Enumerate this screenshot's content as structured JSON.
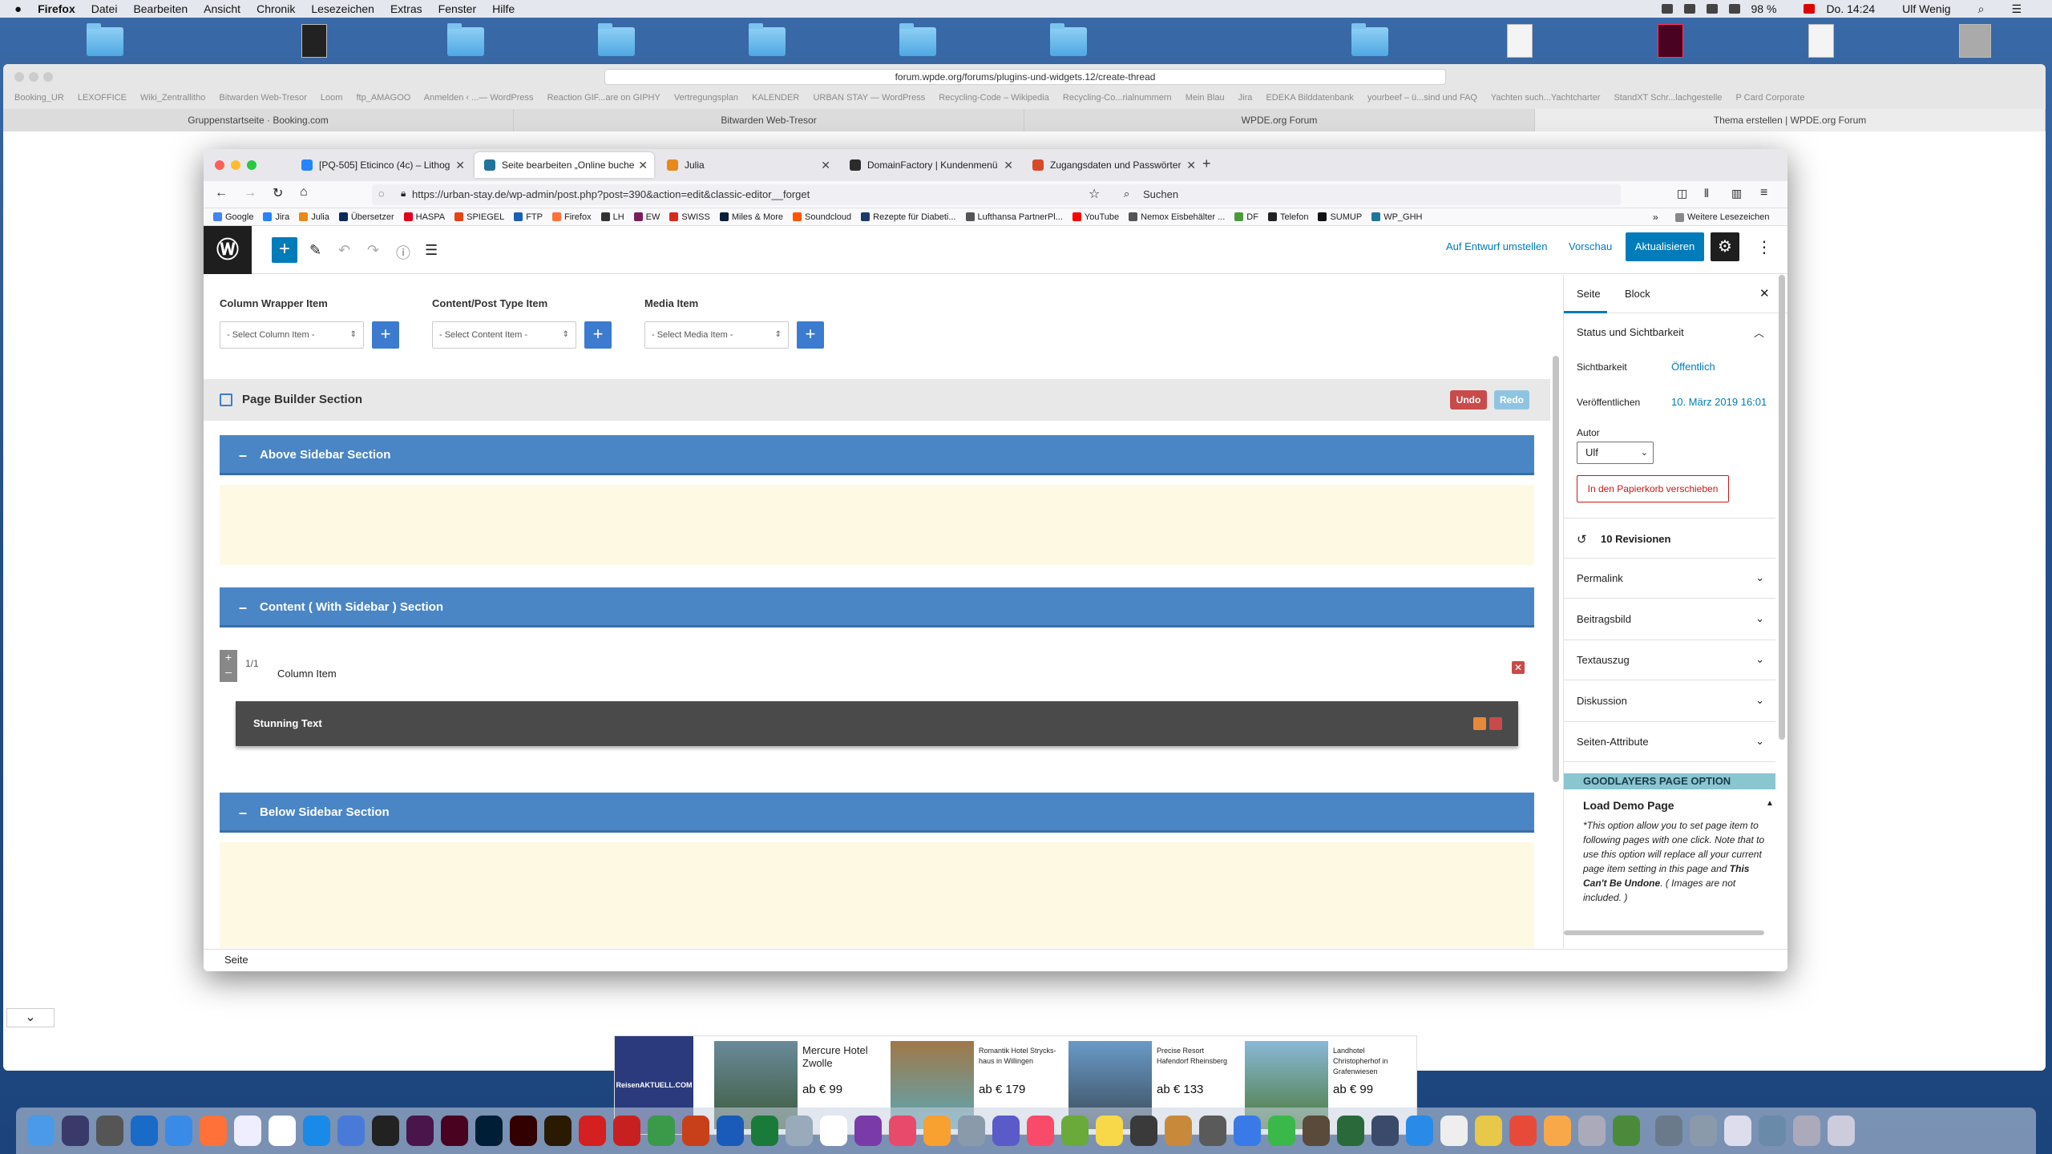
{
  "menubar": {
    "app": "Firefox",
    "items": [
      "Datei",
      "Bearbeiten",
      "Ansicht",
      "Chronik",
      "Lesezeichen",
      "Extras",
      "Fenster",
      "Hilfe"
    ],
    "battery": "98 %",
    "clock": "Do. 14:24",
    "user": "Ulf Wenig"
  },
  "bg_browser": {
    "url": "forum.wpde.org/forums/plugins-und-widgets.12/create-thread",
    "bookmarks": [
      "Booking_UR",
      "LEXOFFICE",
      "Wiki_Zentrallitho",
      "Bitwarden Web-Tresor",
      "Loom",
      "ftp_AMAGOO",
      "Anmelden ‹ ...— WordPress",
      "Reaction GIF...are on GIPHY",
      "Vertregungsplan",
      "KALENDER",
      "URBAN STAY — WordPress",
      "Recycling-Code – Wikipedia",
      "Recycling-Co...rialnummern",
      "Mein Blau",
      "Jira",
      "EDEKA Bilddatenbank",
      "yourbeef – ü...sind und FAQ",
      "Yachten such...Yachtcharter",
      "StandXT Schr...lachgestelle",
      "P Card Corporate"
    ],
    "tabs": [
      "Gruppenstartseite · Booking.com",
      "Bitwarden Web-Tresor",
      "WPDE.org Forum",
      "Thema erstellen | WPDE.org Forum"
    ]
  },
  "firefox": {
    "tabs": [
      {
        "label": "[PQ-505] Eticinco (4c) – Lithog",
        "color": "#2684ff"
      },
      {
        "label": "Seite bearbeiten „Online buche",
        "color": "#21759b"
      },
      {
        "label": "Julia",
        "color": "#e8891a"
      },
      {
        "label": "DomainFactory | Kundenmenü",
        "color": "#2b2b2b"
      },
      {
        "label": "Zugangsdaten und Passwörter",
        "color": "#d64a2a"
      }
    ],
    "url": "https://urban-stay.de/wp-admin/post.php?post=390&action=edit&classic-editor__forget",
    "search_placeholder": "Suchen",
    "bookmarks": [
      {
        "label": "Google",
        "color": "#4285f4"
      },
      {
        "label": "Jira",
        "color": "#2684ff"
      },
      {
        "label": "Julia",
        "color": "#e8891a"
      },
      {
        "label": "Übersetzer",
        "color": "#0a2a5a"
      },
      {
        "label": "HASPA",
        "color": "#e2001a"
      },
      {
        "label": "SPIEGEL",
        "color": "#e64415"
      },
      {
        "label": "FTP",
        "color": "#1a5fb4"
      },
      {
        "label": "Firefox",
        "color": "#ff7139"
      },
      {
        "label": "LH",
        "color": "#333333"
      },
      {
        "label": "EW",
        "color": "#7a1f5c"
      },
      {
        "label": "SWISS",
        "color": "#d52b1e"
      },
      {
        "label": "Miles & More",
        "color": "#0b1f3a"
      },
      {
        "label": "Soundcloud",
        "color": "#ff5500"
      },
      {
        "label": "Rezepte für Diabeti...",
        "color": "#1a3a6a"
      },
      {
        "label": "Lufthansa PartnerPl...",
        "color": "#555555"
      },
      {
        "label": "YouTube",
        "color": "#ff0000"
      },
      {
        "label": "Nemox Eisbehälter ...",
        "color": "#555555"
      },
      {
        "label": "DF",
        "color": "#4a9a3a"
      },
      {
        "label": "Telefon",
        "color": "#222222"
      },
      {
        "label": "SUMUP",
        "color": "#111111"
      },
      {
        "label": "WP_GHH",
        "color": "#21759b"
      }
    ],
    "more_bookmarks": "Weitere Lesezeichen"
  },
  "wp": {
    "toolbar": {
      "draft": "Auf Entwurf umstellen",
      "preview": "Vorschau",
      "update": "Aktualisieren"
    },
    "builder": {
      "column_label": "Column Wrapper Item",
      "column_select": "- Select Column Item -",
      "content_label": "Content/Post Type Item",
      "content_select": "- Select Content Item -",
      "media_label": "Media Item",
      "media_select": "- Select Media Item -",
      "section_title": "Page Builder Section",
      "undo": "Undo",
      "redo": "Redo",
      "above": "Above Sidebar Section",
      "content_section": "Content ( With Sidebar ) Section",
      "below": "Below Sidebar Section",
      "column_fraction": "1/1",
      "column_item": "Column Item",
      "stunning": "Stunning Text"
    },
    "sidebar": {
      "tab_page": "Seite",
      "tab_block": "Block",
      "status": "Status und Sichtbarkeit",
      "visibility_label": "Sichtbarkeit",
      "visibility_value": "Öffentlich",
      "publish_label": "Veröffentlichen",
      "publish_value": "10. März 2019 16:01",
      "author_label": "Autor",
      "author_value": "Ulf",
      "trash": "In den Papierkorb verschieben",
      "revisions": "10 Revisionen",
      "panels": [
        "Permalink",
        "Beitragsbild",
        "Textauszug",
        "Diskussion",
        "Seiten-Attribute"
      ],
      "goodlayers": "GOODLAYERS PAGE OPTION",
      "load_demo": "Load Demo Page",
      "note_a": "*This option allow you to set page item to following pages with one click. Note that to use this option will replace all your current page item setting in this page and ",
      "note_b": "This Can't Be Undone",
      "note_c": ". ( Images are not included. )"
    },
    "footer": "Seite"
  },
  "ad": {
    "logo": "ReisenAKTUELL.COM",
    "items": [
      {
        "title": "Mercure Hotel Zwolle",
        "price": "ab € 99"
      },
      {
        "title": "Romantik Hotel Strycks­haus in Willingen",
        "price": "ab € 179"
      },
      {
        "title": "Precise Resort Hafendorf Rheinsberg",
        "price": "ab € 133"
      },
      {
        "title": "Landhotel Christopherhof in Grafenwiesen",
        "price": "ab € 99"
      }
    ]
  }
}
